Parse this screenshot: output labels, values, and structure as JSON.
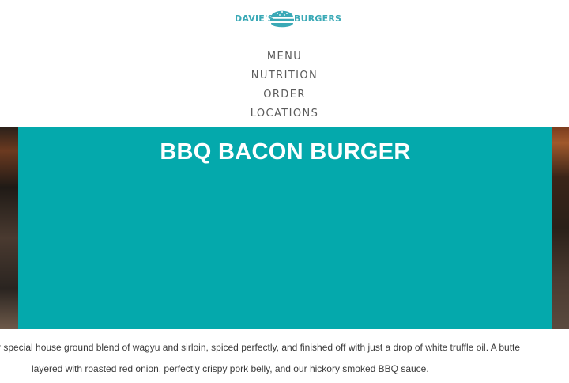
{
  "brand": {
    "name_left": "DAVIE'S",
    "name_right": "BURGERS",
    "brand_color": "#3aa9b6",
    "logo_icon": "burger-bun-icon"
  },
  "nav": {
    "items": [
      "MENU",
      "NUTRITION",
      "ORDER",
      "LOCATIONS"
    ]
  },
  "hero": {
    "title": "BBQ BACON BURGER",
    "panel_color": "#04a9ac"
  },
  "description": {
    "line1": "r special house ground blend of wagyu and sirloin, spiced perfectly, and finished off with just a drop of white truffle oil. A butte",
    "line2": "layered with roasted red onion, perfectly crispy pork belly, and our hickory smoked BBQ sauce."
  }
}
